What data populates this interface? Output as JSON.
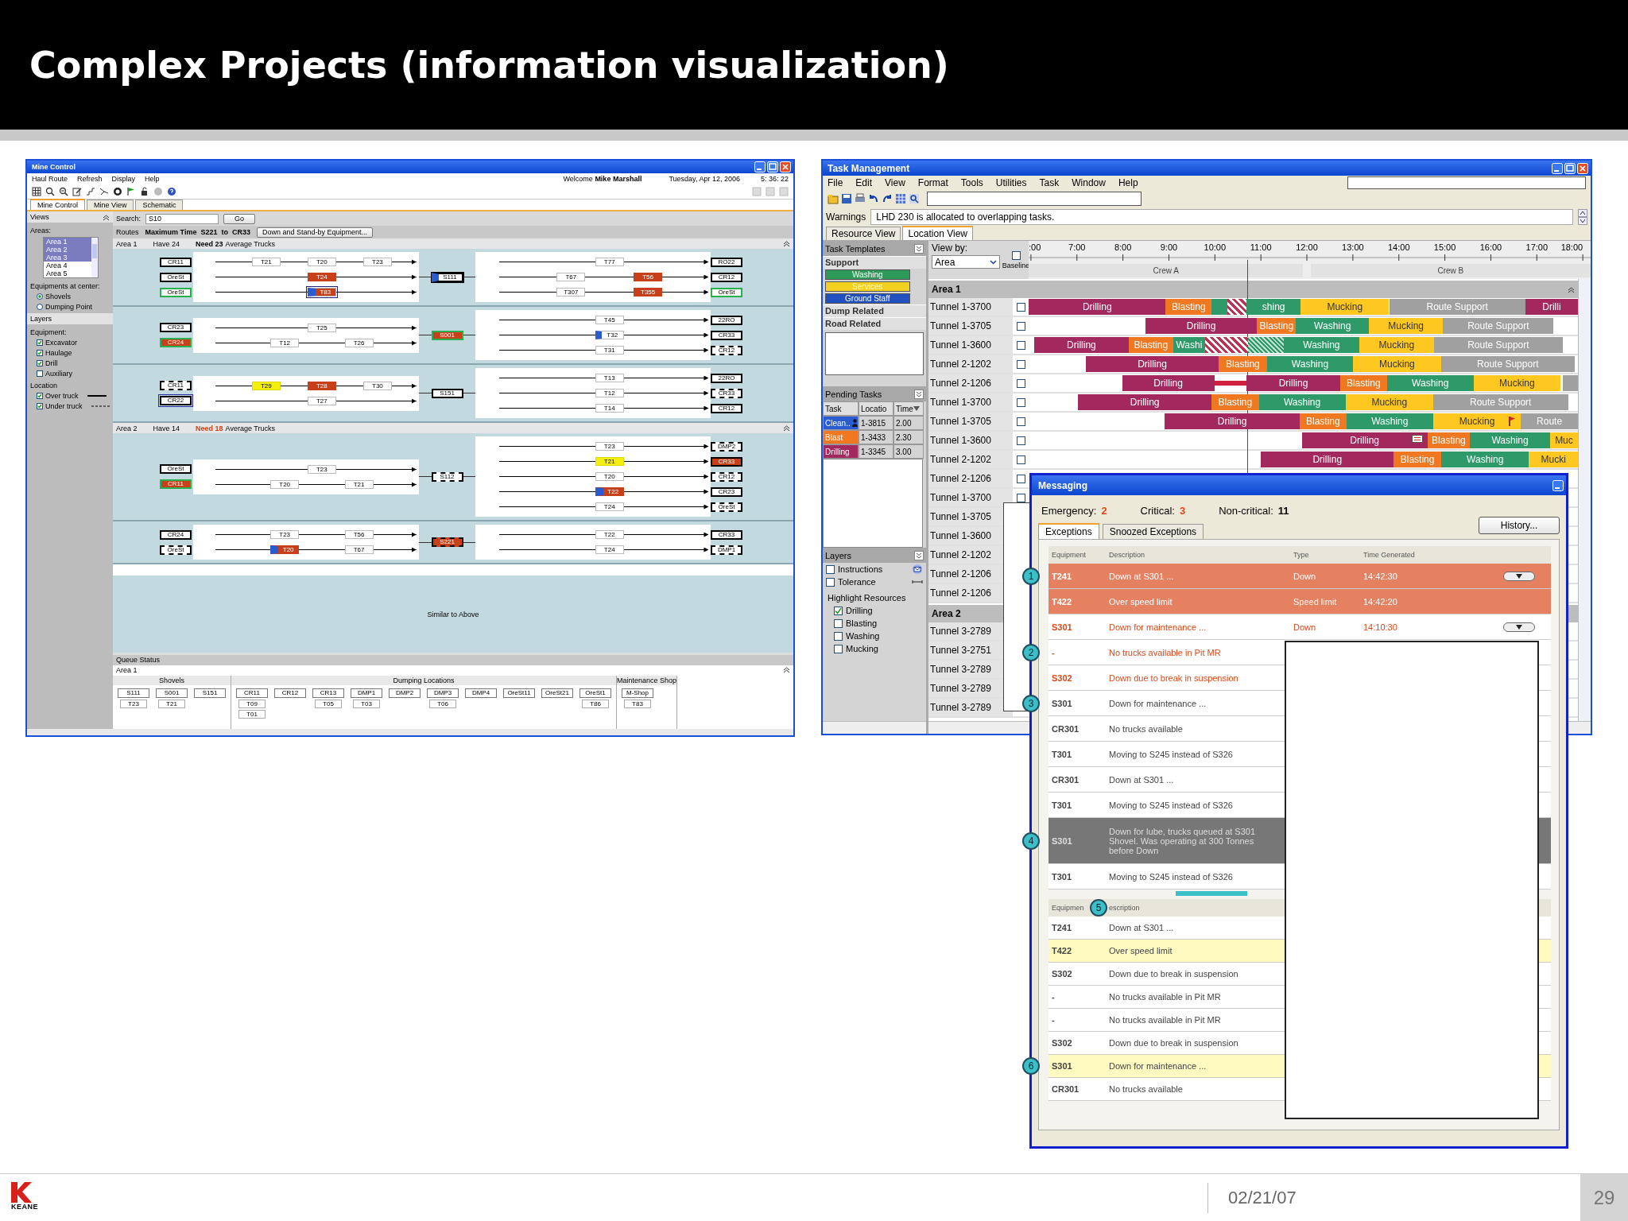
{
  "slide": {
    "title": "Complex Projects (information visualization)",
    "logo": "KEANE",
    "date": "02/21/07",
    "page": "29"
  },
  "mine_control": {
    "title": "Mine Control",
    "menu": [
      "Haul Route",
      "Refresh",
      "Display",
      "Help"
    ],
    "welcome": "Welcome **Mike Marshall**",
    "date": "Tuesday, Apr 12, 2006",
    "time": "5: 36: 22",
    "tabs": [
      {
        "label": "Mine Control",
        "selected": true
      },
      {
        "label": "Mine View",
        "selected": false
      },
      {
        "label": "Schematic",
        "selected": false
      }
    ],
    "sidebar": {
      "views_title": "Views",
      "areas_label": "Areas:",
      "areas": [
        {
          "label": "Area 1",
          "selected": true
        },
        {
          "label": "Area 2",
          "selected": true
        },
        {
          "label": "Area 3",
          "selected": true
        },
        {
          "label": "Area 4",
          "selected": false
        },
        {
          "label": "Area 5",
          "selected": false
        }
      ],
      "center_label": "Equipments at center:",
      "center_options": [
        {
          "label": "Shovels",
          "selected": true
        },
        {
          "label": "Dumping Point",
          "selected": false
        }
      ],
      "layers_title": "Layers",
      "equipment_label": "Equipment:",
      "equipment": [
        {
          "label": "Excavator",
          "checked": true
        },
        {
          "label": "Haulage",
          "checked": true
        },
        {
          "label": "Drill",
          "checked": true
        },
        {
          "label": "Auxiliary",
          "checked": false
        }
      ],
      "location_label": "Location",
      "location": [
        {
          "label": "Over truck",
          "checked": true,
          "kind": "solid"
        },
        {
          "label": "Under truck",
          "checked": true,
          "kind": "dashed"
        }
      ]
    },
    "search": {
      "label": "Search:",
      "value": "S10",
      "button": "Go"
    },
    "routes": {
      "label": "Routes",
      "summary": "Maximum Time  S221  to  CR33",
      "button": "Down and Stand-by Equipment..."
    },
    "areas": [
      {
        "name": "Area 1",
        "have": "Have 24",
        "need": "Need 23",
        "need_alert": false,
        "need_suffix": "Average Trucks",
        "groups": [
          {
            "sources": [
              {
                "label": "CR11",
                "kind": "solid",
                "trucks": [
                  {
                    "label": "T21",
                    "kind": "plain"
                  },
                  {
                    "label": "T20",
                    "kind": "plain"
                  },
                  {
                    "label": "T23",
                    "kind": "plain"
                  }
                ]
              },
              {
                "label": "OreSt",
                "kind": "solid",
                "trucks": [
                  {
                    "label": "T24",
                    "kind": "red"
                  }
                ]
              },
              {
                "label": "OreSt",
                "kind": "green",
                "trucks": [
                  {
                    "label": "T83",
                    "kind": "marked"
                  }
                ]
              }
            ],
            "hub": {
              "label": "S111",
              "kind": "blue"
            },
            "routes": [
              {
                "trucks": [
                  {
                    "label": "T77",
                    "kind": "plain"
                  }
                ],
                "dest": {
                  "label": "RO22",
                  "kind": "solid"
                }
              },
              {
                "trucks": [
                  {
                    "label": "T67",
                    "kind": "plain"
                  },
                  {
                    "label": "T56",
                    "kind": "red"
                  }
                ],
                "dest": {
                  "label": "CR12",
                  "kind": "solid"
                }
              },
              {
                "trucks": [
                  {
                    "label": "T307",
                    "kind": "plain"
                  },
                  {
                    "label": "T355",
                    "kind": "red"
                  }
                ],
                "dest": {
                  "label": "OreSt",
                  "kind": "green"
                }
              }
            ]
          },
          {
            "sources": [
              {
                "label": "CR23",
                "kind": "solid",
                "trucks": [
                  {
                    "label": "T25",
                    "kind": "plain"
                  }
                ]
              },
              {
                "label": "CR24",
                "kind": "red",
                "trucks": [
                  {
                    "label": "T12",
                    "kind": "plain"
                  },
                  {
                    "label": "T26",
                    "kind": "plain"
                  }
                ]
              }
            ],
            "hub": {
              "label": "S001",
              "kind": "red"
            },
            "routes": [
              {
                "trucks": [
                  {
                    "label": "T45",
                    "kind": "plain"
                  }
                ],
                "dest": {
                  "label": "22RO",
                  "kind": "solid"
                }
              },
              {
                "trucks": [
                  {
                    "label": "T32",
                    "kind": "blue"
                  }
                ],
                "dest": {
                  "label": "CR33",
                  "kind": "solid"
                }
              },
              {
                "trucks": [
                  {
                    "label": "T31",
                    "kind": "plain"
                  }
                ],
                "dest": {
                  "label": "CR12",
                  "kind": "dashed"
                }
              }
            ]
          },
          {
            "sources": [
              {
                "label": "CR11",
                "kind": "dashed",
                "trucks": [
                  {
                    "label": "T29",
                    "kind": "yellow"
                  },
                  {
                    "label": "T28",
                    "kind": "red"
                  },
                  {
                    "label": "T30",
                    "kind": "plain"
                  }
                ]
              },
              {
                "label": "CR22",
                "kind": "selected",
                "trucks": [
                  {
                    "label": "T27",
                    "kind": "plain"
                  }
                ]
              }
            ],
            "hub": {
              "label": "S151",
              "kind": "solid"
            },
            "routes": [
              {
                "trucks": [
                  {
                    "label": "T13",
                    "kind": "plain"
                  }
                ],
                "dest": {
                  "label": "22RO",
                  "kind": "solid"
                }
              },
              {
                "trucks": [
                  {
                    "label": "T12",
                    "kind": "plain"
                  }
                ],
                "dest": {
                  "label": "CR33",
                  "kind": "dashed"
                }
              },
              {
                "trucks": [
                  {
                    "label": "T14",
                    "kind": "plain"
                  }
                ],
                "dest": {
                  "label": "CR12",
                  "kind": "solid"
                }
              }
            ]
          }
        ]
      },
      {
        "name": "Area 2",
        "have": "Have 14",
        "need": "Need 18",
        "need_alert": true,
        "need_suffix": "Average Trucks",
        "groups": [
          {
            "sources": [
              {
                "label": "OreSt",
                "kind": "solid",
                "trucks": [
                  {
                    "label": "T23",
                    "kind": "plain"
                  }
                ]
              },
              {
                "label": "CR11",
                "kind": "red",
                "trucks": [
                  {
                    "label": "T20",
                    "kind": "plain"
                  },
                  {
                    "label": "T21",
                    "kind": "plain"
                  }
                ]
              }
            ],
            "hub": {
              "label": "S112",
              "kind": "dashed"
            },
            "routes": [
              {
                "trucks": [
                  {
                    "label": "T23",
                    "kind": "plain"
                  }
                ],
                "dest": {
                  "label": "DMP2",
                  "kind": "dashed"
                }
              },
              {
                "trucks": [
                  {
                    "label": "T21",
                    "kind": "yellow"
                  }
                ],
                "dest": {
                  "label": "CR33",
                  "kind": "redfill"
                }
              },
              {
                "trucks": [
                  {
                    "label": "T20",
                    "kind": "plain"
                  }
                ],
                "dest": {
                  "label": "CR12",
                  "kind": "dashed"
                }
              },
              {
                "trucks": [
                  {
                    "label": "T22",
                    "kind": "blue-red"
                  }
                ],
                "dest": {
                  "label": "CR23",
                  "kind": "solid"
                }
              },
              {
                "trucks": [
                  {
                    "label": "T24",
                    "kind": "plain"
                  }
                ],
                "dest": {
                  "label": "OreSt",
                  "kind": "dashed"
                }
              }
            ]
          },
          {
            "sources": [
              {
                "label": "CR24",
                "kind": "solid",
                "trucks": [
                  {
                    "label": "T23",
                    "kind": "plain"
                  },
                  {
                    "label": "T56",
                    "kind": "plain"
                  }
                ]
              },
              {
                "label": "OreSt",
                "kind": "dashed",
                "trucks": [
                  {
                    "label": "T20",
                    "kind": "blue-red"
                  },
                  {
                    "label": "T67",
                    "kind": "plain"
                  }
                ]
              }
            ],
            "hub": {
              "label": "S221",
              "kind": "red-dashed"
            },
            "routes": [
              {
                "trucks": [
                  {
                    "label": "T22",
                    "kind": "plain"
                  }
                ],
                "dest": {
                  "label": "CR33",
                  "kind": "solid"
                }
              },
              {
                "trucks": [
                  {
                    "label": "T24",
                    "kind": "plain"
                  }
                ],
                "dest": {
                  "label": "DMP1",
                  "kind": "dashed"
                }
              }
            ]
          }
        ]
      }
    ],
    "placeholder": "Similar to Above",
    "queue": {
      "title": "Queue Status",
      "area": "Area 1",
      "sections": [
        {
          "title": "Shovels",
          "items": [
            {
              "label": "S111",
              "trucks": [
                "T23"
              ]
            },
            {
              "label": "S001",
              "trucks": [
                "T21"
              ]
            },
            {
              "label": "S151"
            }
          ]
        },
        {
          "title": "Dumping Locations",
          "items": [
            {
              "label": "CR11",
              "trucks": [
                "T09",
                "T01"
              ]
            },
            {
              "label": "CR12"
            },
            {
              "label": "CR13",
              "trucks": [
                "T05"
              ]
            },
            {
              "label": "DMP1",
              "trucks": [
                "T03"
              ]
            },
            {
              "label": "DMP2"
            },
            {
              "label": "DMP3",
              "trucks": [
                "T06"
              ]
            },
            {
              "label": "DMP4"
            },
            {
              "label": "OreSt11"
            },
            {
              "label": "OreSt21"
            },
            {
              "label": "OreSt1",
              "trucks": [
                "T86"
              ]
            }
          ]
        },
        {
          "title": "Maintenance Shop",
          "items": [
            {
              "label": "M-Shop",
              "trucks": [
                "T83"
              ]
            }
          ]
        }
      ]
    }
  },
  "task_management": {
    "title": "Task Management",
    "menu": [
      "File",
      "Edit",
      "View",
      "Format",
      "Tools",
      "Utilities",
      "Task",
      "Window",
      "Help"
    ],
    "warnings_label": "Warnings",
    "warning": "LHD 230 is allocated to overlapping tasks.",
    "tabs": [
      {
        "label": "Resource View",
        "selected": false
      },
      {
        "label": "Location View",
        "selected": true
      }
    ],
    "templates": {
      "title": "Task Templates",
      "groups": [
        {
          "label": "Support",
          "items": [
            {
              "label": "Washing",
              "kind": "washing"
            },
            {
              "label": "Services",
              "kind": "services"
            },
            {
              "label": "Ground Staff",
              "kind": "staff"
            }
          ]
        },
        {
          "label": "Dump Related"
        },
        {
          "label": "Road Related"
        }
      ]
    },
    "pending": {
      "title": "Pending Tasks",
      "columns": [
        "Task",
        "Locatio",
        "Time"
      ],
      "rows": [
        {
          "task": "Clean..",
          "kind": "cleaning",
          "location": "1-3815",
          "time": "2.00"
        },
        {
          "task": "Blast",
          "kind": "blasting",
          "location": "1-3433",
          "time": "2.30"
        },
        {
          "task": "Drilling",
          "kind": "drilling",
          "location": "1-3345",
          "time": "3.00"
        }
      ]
    },
    "layers": {
      "title": "Layers",
      "items": [
        {
          "label": "Instructions",
          "checked": false,
          "kind": "envelope"
        },
        {
          "label": "Tolerance",
          "checked": false,
          "kind": "range"
        }
      ],
      "highlight_label": "Highlight Resources",
      "highlight": [
        {
          "label": "Drilling",
          "checked": true
        },
        {
          "label": "Blasting",
          "checked": false
        },
        {
          "label": "Washing",
          "checked": false
        },
        {
          "label": "Mucking",
          "checked": false
        }
      ]
    },
    "gantt": {
      "view_by_label": "View by:",
      "view_by": "Area",
      "baseline": "Baseline",
      "baseline_checked": false,
      "ticks": [
        ":00",
        "7:00",
        "8:00",
        "9:00",
        "10:00",
        "11:00",
        "12:00",
        "13:00",
        "14:00",
        "15:00",
        "16:00",
        "17:00",
        "18:00"
      ],
      "crews": [
        "Crew A",
        "Crew B"
      ],
      "groups": [
        {
          "name": "Area 1",
          "expanded": true,
          "rows": [
            {
              "name": "Tunnel 1-3700",
              "checked": false,
              "bars": [
                {
                  "label": "Drilling",
                  "kind": "drilling"
                },
                {
                  "label": "Blasting",
                  "kind": "blasting"
                },
                {
                  "kind": "washing"
                },
                {
                  "kind": "hatch-red"
                },
                {
                  "label": "shing",
                  "kind": "washing"
                },
                {
                  "label": "Mucking",
                  "kind": "mucking"
                },
                {
                  "label": "Route Support",
                  "kind": "route"
                },
                {
                  "label": "Drilli",
                  "kind": "drilling"
                }
              ]
            },
            {
              "name": "Tunnel 1-3705",
              "checked": false,
              "bars": [
                {
                  "label": "Drilling",
                  "kind": "drilling"
                },
                {
                  "label": "Blasting",
                  "kind": "blasting"
                },
                {
                  "label": "Washing",
                  "kind": "washing"
                },
                {
                  "label": "Mucking",
                  "kind": "mucking"
                },
                {
                  "label": "Route Support",
                  "kind": "route"
                }
              ]
            },
            {
              "name": "Tunnel 1-3600",
              "checked": false,
              "bars": [
                {
                  "label": "Drilling",
                  "kind": "drilling"
                },
                {
                  "label": "Blasting",
                  "kind": "blasting"
                },
                {
                  "label": "Washi",
                  "kind": "washing"
                },
                {
                  "kind": "hatch-red"
                },
                {
                  "kind": "hatch-green"
                },
                {
                  "label": "Washing",
                  "kind": "washing"
                },
                {
                  "label": "Mucking",
                  "kind": "mucking"
                },
                {
                  "label": "Route Support",
                  "kind": "route"
                }
              ]
            },
            {
              "name": "Tunnel 2-1202",
              "checked": false,
              "bars": [
                {
                  "label": "Drilling",
                  "kind": "drilling"
                },
                {
                  "label": "Blasting",
                  "kind": "blasting"
                },
                {
                  "label": "Washing",
                  "kind": "washing"
                },
                {
                  "label": "Mucking",
                  "kind": "mucking"
                },
                {
                  "label": "Route Support",
                  "kind": "route"
                }
              ]
            },
            {
              "name": "Tunnel 2-1206",
              "checked": false,
              "bars": [
                {
                  "label": "Drilling",
                  "kind": "drilling"
                },
                {
                  "kind": "conflict"
                },
                {
                  "label": "Drilling",
                  "kind": "drilling"
                },
                {
                  "label": "Blasting",
                  "kind": "blasting"
                },
                {
                  "label": "Washing",
                  "kind": "washing"
                },
                {
                  "label": "Mucking",
                  "kind": "mucking"
                },
                {
                  "kind": "route"
                }
              ]
            },
            {
              "name": "Tunnel 1-3700",
              "checked": false,
              "bars": [
                {
                  "label": "Drilling",
                  "kind": "drilling"
                },
                {
                  "label": "Blasting",
                  "kind": "blasting"
                },
                {
                  "label": "Washing",
                  "kind": "washing"
                },
                {
                  "label": "Mucking",
                  "kind": "mucking"
                },
                {
                  "label": "Route Support",
                  "kind": "route"
                }
              ]
            },
            {
              "name": "Tunnel 1-3705",
              "checked": false,
              "bars": [
                {
                  "label": "Drilling",
                  "kind": "drilling"
                },
                {
                  "label": "Blasting",
                  "kind": "blasting"
                },
                {
                  "label": "Washing",
                  "kind": "washing"
                },
                {
                  "label": "Mucking",
                  "kind": "mucking"
                },
                {
                  "label": "Route",
                  "kind": "route"
                }
              ]
            },
            {
              "name": "Tunnel 1-3600",
              "checked": false,
              "bars": [
                {
                  "label": "Drilling",
                  "kind": "drilling"
                },
                {
                  "label": "Blasting",
                  "kind": "blasting"
                },
                {
                  "label": "Washing",
                  "kind": "washing"
                },
                {
                  "label": "Muc",
                  "kind": "mucking"
                }
              ]
            },
            {
              "name": "Tunnel 2-1202",
              "checked": false,
              "bars": [
                {
                  "label": "Drilling",
                  "kind": "drilling"
                },
                {
                  "label": "Blasting",
                  "kind": "blasting"
                },
                {
                  "label": "Washing",
                  "kind": "washing"
                },
                {
                  "label": "Mucki",
                  "kind": "mucking"
                }
              ]
            },
            {
              "name": "Tunnel 2-1206",
              "checked": false
            },
            {
              "name": "Tunnel 1-3700",
              "checked": false
            },
            {
              "name": "Tunnel 1-3705"
            },
            {
              "name": "Tunnel 1-3600"
            },
            {
              "name": "Tunnel 2-1202"
            },
            {
              "name": "Tunnel 2-1206"
            },
            {
              "name": "Tunnel 2-1206"
            }
          ]
        },
        {
          "name": "Area 2",
          "rows": [
            {
              "name": "Tunnel 3-2789"
            },
            {
              "name": "Tunnel 3-2751"
            },
            {
              "name": "Tunnel 3-2789"
            },
            {
              "name": "Tunnel 3-2789"
            },
            {
              "name": "Tunnel 3-2789"
            }
          ]
        }
      ]
    }
  },
  "messaging": {
    "title": "Messaging",
    "counts": [
      {
        "label": "Emergency:",
        "value": "2",
        "kind": "alert"
      },
      {
        "label": "Critical:",
        "value": "3",
        "kind": "alert"
      },
      {
        "label": "Non-critical:",
        "value": "11",
        "kind": "plain"
      }
    ],
    "history_button": "History...",
    "tabs": [
      {
        "label": "Exceptions",
        "selected": true
      },
      {
        "label": "Snoozed Exceptions",
        "selected": false
      }
    ],
    "columns": [
      "Equipment",
      "Description",
      "Type",
      "Time Generated"
    ],
    "rows": [
      {
        "equipment": "T241",
        "description": "Down at S301  ...",
        "type": "Down",
        "time": "14:42:30",
        "menu": true,
        "kind": "emergency",
        "callout": "1"
      },
      {
        "equipment": "T422",
        "description": "Over speed limit",
        "type": "Speed limit",
        "time": "14:42:20",
        "menu": false,
        "kind": "emergency"
      },
      {
        "equipment": "S301",
        "description": "Down for maintenance  ...",
        "type": "Down",
        "time": "14:10:30",
        "menu": true,
        "kind": "critical"
      },
      {
        "equipment": "-",
        "description": "No trucks available in Pit MR",
        "kind": "critical",
        "callout": "2"
      },
      {
        "equipment": "S302",
        "description": "Down due to break in suspension",
        "kind": "critical"
      },
      {
        "equipment": "S301",
        "description": "Down for maintenance  ...",
        "kind": "normal",
        "callout": "3"
      },
      {
        "equipment": "CR301",
        "description": "No trucks available",
        "kind": "normal"
      },
      {
        "equipment": "T301",
        "description": "Moving to S245 instead of S326",
        "kind": "normal"
      },
      {
        "equipment": "CR301",
        "description": "Down at S301  ...",
        "kind": "normal"
      },
      {
        "equipment": "T301",
        "description": "Moving to S245 instead of S326",
        "kind": "normal"
      },
      {
        "equipment": "S301",
        "description": "Down for lube, trucks queued at S301 Shovel. Was operating at 300 Tonnes before Down",
        "kind": "selected",
        "callout": "4"
      },
      {
        "equipment": "T301",
        "description": "Moving to S245 instead of S326",
        "kind": "normal"
      }
    ],
    "history_columns": [
      "Equipmen",
      "escription"
    ],
    "history_callout": "5",
    "history_rows": [
      {
        "equipment": "T241",
        "description": "Down at S301  ...",
        "kind": "normal"
      },
      {
        "equipment": "T422",
        "description": "Over speed limit",
        "kind": "highlight"
      },
      {
        "equipment": "S302",
        "description": "Down due to break in suspension",
        "kind": "normal"
      },
      {
        "equipment": "-",
        "description": "No trucks available in Pit MR",
        "kind": "normal"
      },
      {
        "equipment": "-",
        "description": "No trucks available in Pit MR",
        "kind": "normal"
      },
      {
        "equipment": "S302",
        "description": "Down due to break in suspension",
        "kind": "normal"
      },
      {
        "equipment": "S301",
        "description": "Down for maintenance  ...",
        "kind": "highlight",
        "callout": "6"
      },
      {
        "equipment": "CR301",
        "description": "No trucks available",
        "kind": "normal"
      }
    ]
  }
}
